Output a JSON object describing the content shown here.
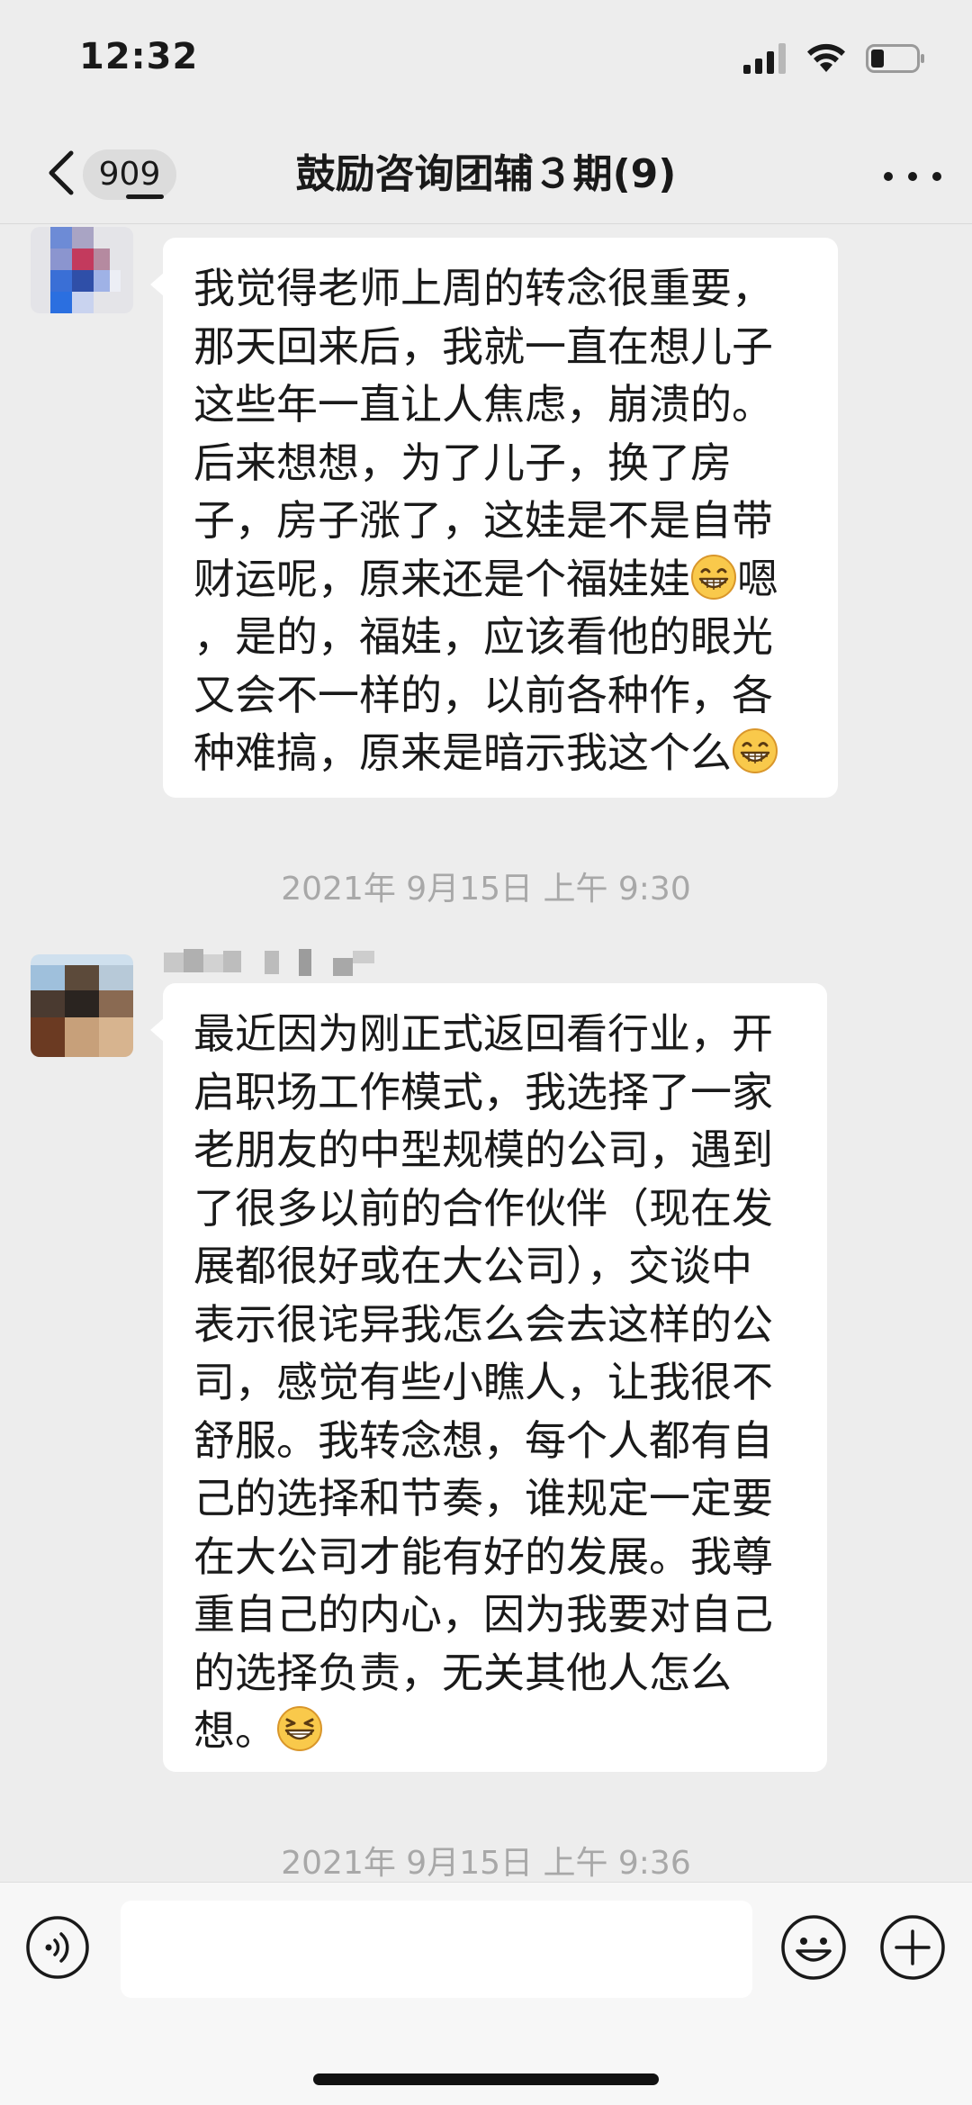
{
  "status_bar": {
    "time": "12:32"
  },
  "nav": {
    "unread_count": "909",
    "title": "鼓励咨询团辅３期(9)"
  },
  "messages": [
    {
      "type": "text",
      "lines": [
        "我觉得老师上周的转念很重要，",
        "那天回来后，我就一直在想儿子",
        "这些年一直让人焦虑，崩溃的。",
        "后来想想，为了儿子，换了房",
        "子，房子涨了，这娃是不是自带",
        "财运呢，原来还是个福娃娃",
        "，是的，福娃，应该看他的眼光",
        "又会不一样的，以前各种作，各",
        "种难搞，原来是暗示我这个么"
      ],
      "line6_tail": "嗯"
    },
    {
      "type": "text",
      "lines": [
        "最近因为刚正式返回看行业，开",
        "启职场工作模式，我选择了一家",
        "老朋友的中型规模的公司，遇到",
        "了很多以前的合作伙伴（现在发",
        "展都很好或在大公司），交谈中",
        "表示很诧异我怎么会去这样的公",
        "司，感觉有些小瞧人，让我很不",
        "舒服。我转念想，每个人都有自",
        "己的选择和节奏，谁规定一定要",
        "在大公司才能有好的发展。我尊",
        "重自己的内心，因为我要对自己",
        "的选择负责，无关其他人怎么",
        "想。"
      ]
    }
  ],
  "timestamps": [
    "2021年 9月15日 上午 9:30",
    "2021年 9月15日 上午 9:36"
  ],
  "icons": {
    "back": "chevron-left-icon",
    "more": "more-dots-icon",
    "voice": "voice-icon",
    "emoji": "emoji-icon",
    "plus": "plus-icon",
    "grin_emoji": "grin-emoji-icon",
    "smirk_emoji": "grin-squint-emoji-icon"
  },
  "colors": {
    "background": "#ededed",
    "bubble": "#ffffff",
    "timestamp": "#a8a8a8"
  }
}
